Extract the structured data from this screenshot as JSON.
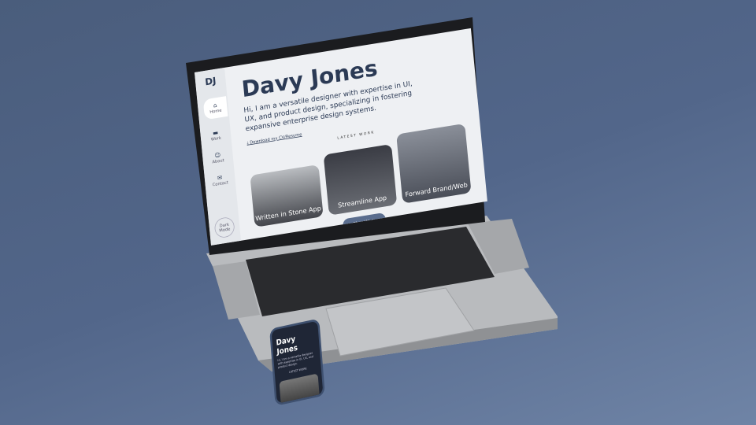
{
  "sidebar": {
    "logo": "DJ",
    "items": [
      {
        "icon": "⌂",
        "label": "Home"
      },
      {
        "icon": "▬",
        "label": "Work"
      },
      {
        "icon": "☺",
        "label": "About"
      },
      {
        "icon": "✉",
        "label": "Contact"
      }
    ],
    "dark_mode": "Dark Mode"
  },
  "hero": {
    "title": "Davy Jones",
    "bio": "Hi, I am a versatile designer with expertise in UI, UX, and product design, specializing in fostering expansive enterprise design systems.",
    "download": "⤓ Download my CV/Resume"
  },
  "work": {
    "heading": "LATEST WORK",
    "cards": [
      "Written in Stone App",
      "Streamline App",
      "Forward Brand/Web"
    ],
    "more": "More Work"
  },
  "phone": {
    "title": "Davy Jones",
    "bio": "Hi, I am a versatile designer with expertise in UI, UX, and product design.",
    "latest": "LATEST WORK"
  }
}
